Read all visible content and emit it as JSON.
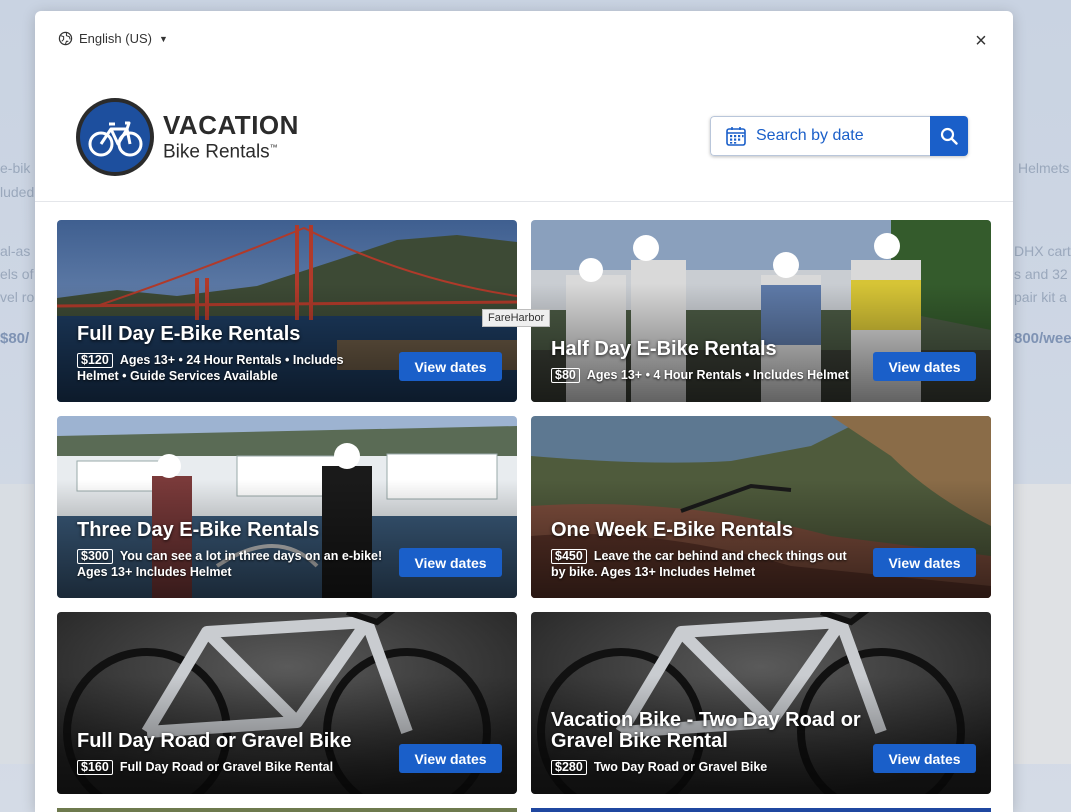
{
  "language": {
    "label": "English (US)"
  },
  "close_label": "×",
  "logo": {
    "title": "VACATION",
    "subtitle": "Bike Rentals",
    "tm": "™"
  },
  "search": {
    "label": "Search by date"
  },
  "tooltip": "FareHarbor",
  "background": {
    "fragments": [
      "e-bik",
      "luded",
      "al-as",
      "els of",
      "vel ro",
      "$80/",
      "Helmets",
      "DHX cart",
      "s and 32",
      "pair kit a",
      "800/wee"
    ]
  },
  "cards": [
    {
      "title": "Full Day E-Bike Rentals",
      "price": "$120",
      "desc": "Ages 13+ • 24 Hour Rentals • Includes Helmet • Guide Services Available",
      "button": "View dates",
      "scene": "bridge"
    },
    {
      "title": "Half Day E-Bike Rentals",
      "price": "$80",
      "desc": "Ages 13+ • 4 Hour Rentals • Includes Helmet",
      "button": "View dates",
      "scene": "group"
    },
    {
      "title": "Three Day E-Bike Rentals",
      "price": "$300",
      "desc": "You can see a lot in three days on an e-bike! Ages 13+ Includes Helmet",
      "button": "View dates",
      "scene": "marina"
    },
    {
      "title": "One Week E-Bike Rentals",
      "price": "$450",
      "desc": "Leave the car behind and check things out by bike. Ages 13+ Includes Helmet",
      "button": "View dates",
      "scene": "coast"
    },
    {
      "title": "Full Day Road or Gravel Bike",
      "price": "$160",
      "desc": "Full Day Road or Gravel Bike Rental",
      "button": "View dates",
      "scene": "roadbike"
    },
    {
      "title": "Vacation Bike - Two Day Road or Gravel Bike Rental",
      "price": "$280",
      "desc": "Two Day Road or Gravel Bike",
      "button": "View dates",
      "scene": "roadbike"
    }
  ],
  "colors": {
    "brand_blue": "#1a5fc9",
    "logo_blue": "#1d4f9e"
  }
}
